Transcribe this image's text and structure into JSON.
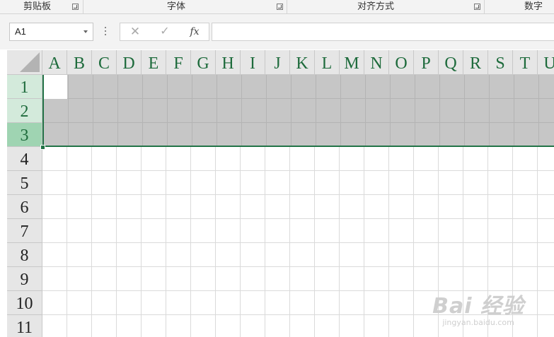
{
  "ribbon": {
    "groups": [
      {
        "label": "剪贴板"
      },
      {
        "label": "字体"
      },
      {
        "label": "对齐方式"
      },
      {
        "label": "数字"
      }
    ]
  },
  "formula_bar": {
    "name_box": "A1",
    "cancel_icon": "✕",
    "enter_icon": "✓",
    "insert_function_label": "fx",
    "formula_value": ""
  },
  "sheet": {
    "columns": [
      "A",
      "B",
      "C",
      "D",
      "E",
      "F",
      "G",
      "H",
      "I",
      "J",
      "K",
      "L",
      "M",
      "N",
      "O",
      "P",
      "Q",
      "R",
      "S",
      "T",
      "U"
    ],
    "rows": [
      "1",
      "2",
      "3",
      "4",
      "5",
      "6",
      "7",
      "8",
      "9",
      "10",
      "11"
    ],
    "selected_rows": [
      "1",
      "2",
      "3"
    ],
    "active_cell": "A1"
  },
  "watermark": {
    "logo": "Bai 经验",
    "url": "jingyan.baidu.com"
  },
  "colors": {
    "accent": "#217346",
    "header_text": "#1e6b3c",
    "selection_fill": "#c6c6c6"
  }
}
